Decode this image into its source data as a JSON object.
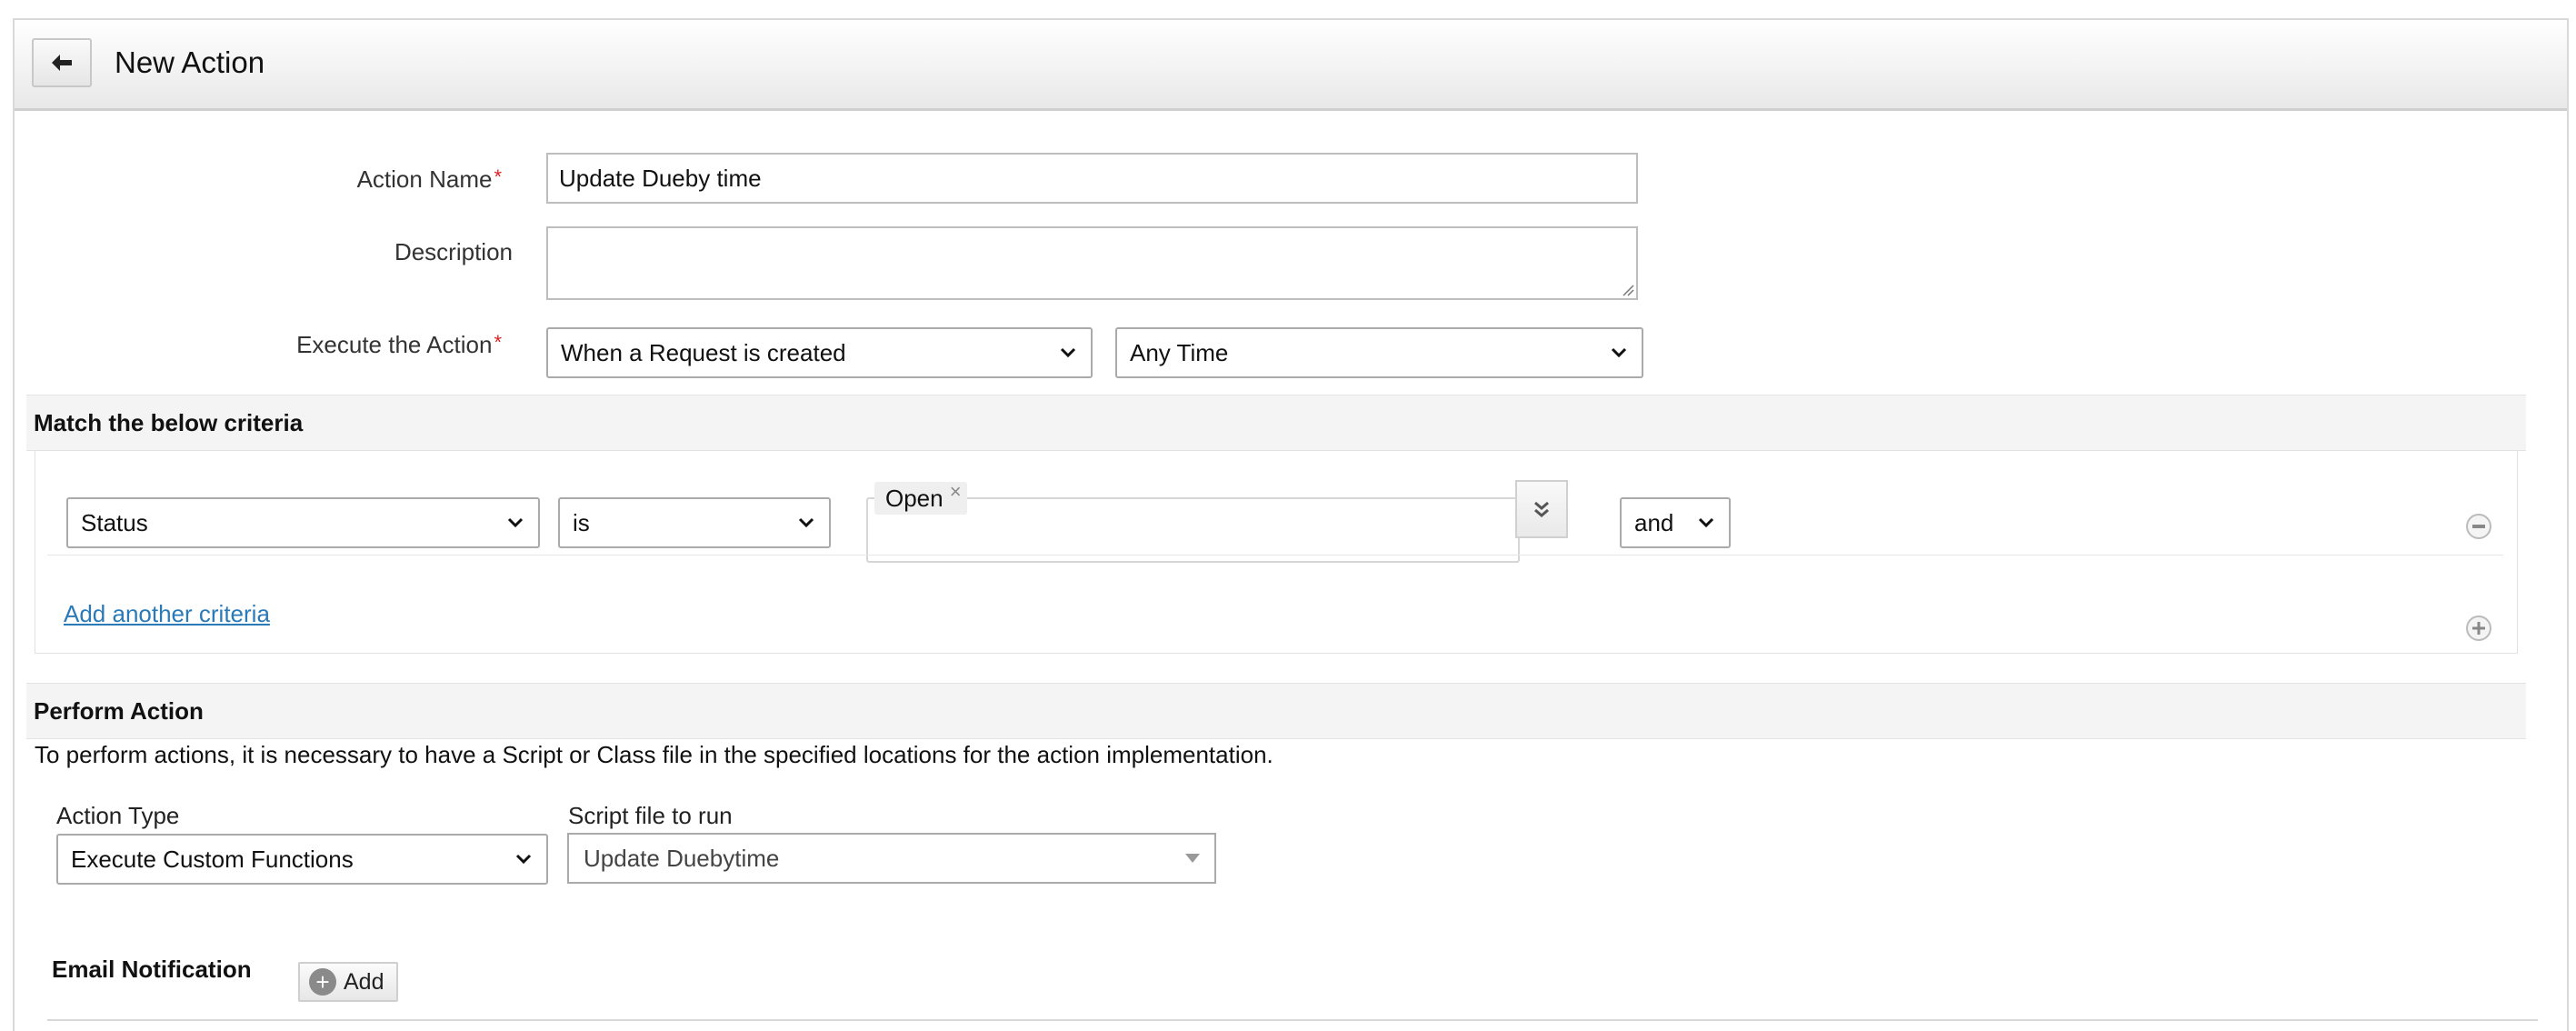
{
  "header": {
    "title": "New Action",
    "back_icon": "arrow-left-icon"
  },
  "form": {
    "action_name_label": "Action Name",
    "action_name_value": "Update Dueby time",
    "description_label": "Description",
    "description_value": "",
    "execute_label": "Execute the Action",
    "execute_when": "When a Request is created",
    "execute_time": "Any Time",
    "required_mark": "*"
  },
  "criteria": {
    "section_title": "Match the below criteria",
    "field": "Status",
    "operator": "is",
    "value_tag": "Open",
    "value_tag_remove": "×",
    "conjunction": "and",
    "add_link": "Add another criteria"
  },
  "perform": {
    "section_title": "Perform Action",
    "note": "To perform actions, it is necessary to have a Script or Class file in the specified locations for the action implementation.",
    "action_type_label": "Action Type",
    "action_type_value": "Execute Custom Functions",
    "script_label": "Script file to run",
    "script_value": "Update Duebytime"
  },
  "email": {
    "label": "Email Notification",
    "add_label": "Add"
  },
  "colors": {
    "link": "#2a7ab8",
    "required": "#dd2222",
    "section_bg": "#f4f4f4"
  }
}
